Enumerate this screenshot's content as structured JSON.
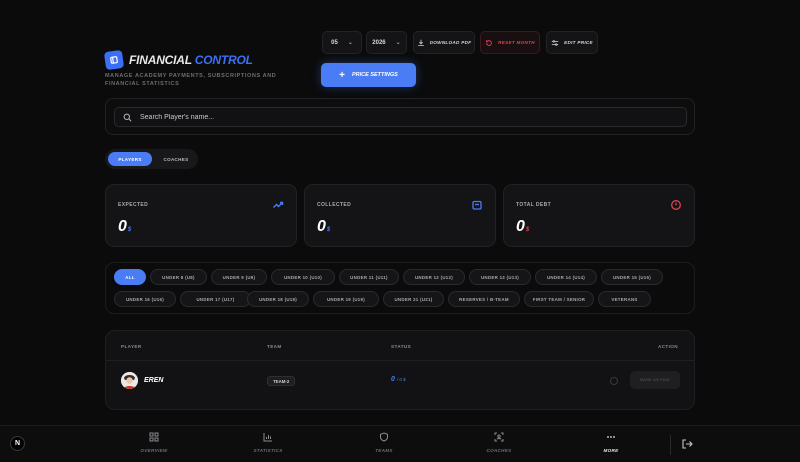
{
  "header": {
    "title_main": "FINANCIAL",
    "title_accent": "CONTROL",
    "subtitle": "MANAGE ACADEMY PAYMENTS, SUBSCRIPTIONS AND FINANCIAL STATISTICS",
    "month": "05",
    "year": "2026",
    "download_label": "DOWNLOAD PDF",
    "reset_label": "RESET MONTH",
    "edit_price_label": "EDIT PRICE",
    "price_settings_label": "PRICE SETTINGS"
  },
  "search": {
    "placeholder": "Search Player's name..."
  },
  "toggle": {
    "players": "PLAYERS",
    "coaches": "COACHES"
  },
  "cards": {
    "expected": {
      "label": "EXPECTED",
      "value": "0",
      "currency": "$"
    },
    "collected": {
      "label": "COLLECTED",
      "value": "0",
      "currency": "$"
    },
    "debt": {
      "label": "TOTAL DEBT",
      "value": "0",
      "currency": "$"
    }
  },
  "filters": [
    "ALL",
    "UNDER 8 (U8)",
    "UNDER 9 (U9)",
    "UNDER 10 (U10)",
    "UNDER 11 (U11)",
    "UNDER 12 (U12)",
    "UNDER 13 (U13)",
    "UNDER 14 (U14)",
    "UNDER 15 (U15)",
    "UNDER 16 (U16)",
    "UNDER 17 (U17)",
    "UNDER 18 (U18)",
    "UNDER 19 (U19)",
    "UNDER 21 (U21)",
    "RESERVES / B-TEAM",
    "FIRST TEAM / SENIOR",
    "VETERANS"
  ],
  "table": {
    "headers": {
      "player": "PLAYER",
      "team": "TEAM",
      "status": "STATUS",
      "action": "ACTION"
    },
    "rows": [
      {
        "name": "EREN",
        "team": "TEAM-2",
        "paid": "0",
        "total": "/ 0 $",
        "action": "MARK AS PAID"
      }
    ]
  },
  "nav": {
    "overview": "OVERVIEW",
    "statistics": "STATISTICS",
    "teams": "TEAMS",
    "coaches": "COACHES",
    "more": "MORE",
    "logo": "N"
  },
  "colors": {
    "accent": "#4a7cf6",
    "danger": "#e0424e",
    "background": "#0b0b0c"
  }
}
